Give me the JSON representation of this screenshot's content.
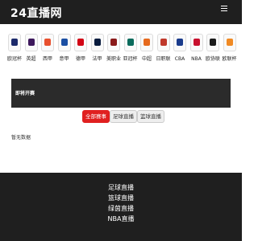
{
  "header": {
    "logo": "24直播网"
  },
  "leagues": [
    {
      "label": "欧冠杯",
      "icon": "ucl-icon",
      "color": "#1c2a6b"
    },
    {
      "label": "英超",
      "icon": "premier-league-icon",
      "color": "#3d185c"
    },
    {
      "label": "西甲",
      "icon": "laliga-icon",
      "color": "#e8502e"
    },
    {
      "label": "意甲",
      "icon": "serie-a-icon",
      "color": "#1b4fa3"
    },
    {
      "label": "德甲",
      "icon": "bundesliga-icon",
      "color": "#d20515"
    },
    {
      "label": "法甲",
      "icon": "ligue1-icon",
      "color": "#091c3e"
    },
    {
      "label": "美职业",
      "icon": "mls-icon",
      "color": "#8a1a1a"
    },
    {
      "label": "亚冠杯",
      "icon": "afc-icon",
      "color": "#0a6b5c"
    },
    {
      "label": "中超",
      "icon": "csl-icon",
      "color": "#e66a1e"
    },
    {
      "label": "日职联",
      "icon": "j-league-icon",
      "color": "#c0392b"
    },
    {
      "label": "CBA",
      "icon": "cba-icon",
      "color": "#1a3b8c"
    },
    {
      "label": "NBA",
      "icon": "nba-icon",
      "color": "#c8102e"
    },
    {
      "label": "欧协联",
      "icon": "uecl-icon",
      "color": "#1a1a1a"
    },
    {
      "label": "欧联杯",
      "icon": "uel-icon",
      "color": "#f08a24"
    }
  ],
  "schedule": {
    "title": "即将开赛",
    "tabs": [
      "全部赛事",
      "足球直播",
      "篮球直播"
    ],
    "active_tab": 0,
    "empty_text": "暂无数据"
  },
  "footer": {
    "links": [
      "足球直播",
      "篮球直播",
      "绿茵直播",
      "NBA直播"
    ]
  }
}
